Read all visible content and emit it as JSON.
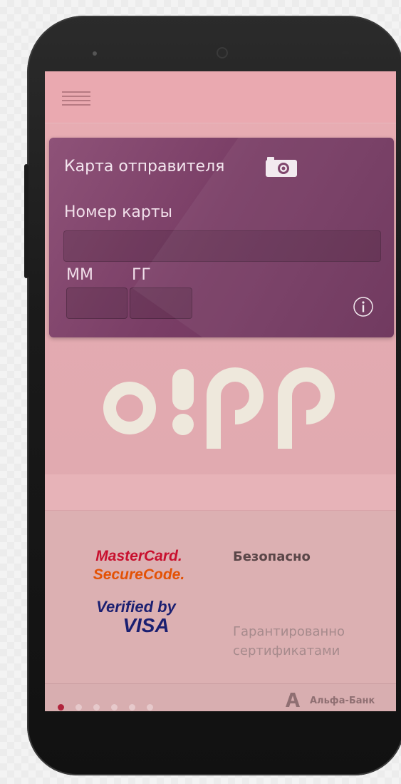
{
  "colors": {
    "screen_bg": "#e8acb3",
    "card_bg": "#7a3e66",
    "logo_fill": "#eee8dc",
    "active_dot": "#b0243c",
    "mastercard_red": "#c8102e",
    "securecode_orange": "#e35205",
    "visa_blue": "#1a1f71"
  },
  "header": {
    "menu_icon": "hamburger-menu-icon"
  },
  "card_form": {
    "title": "Карта отправителя",
    "camera_icon": "camera-icon",
    "card_number_label": "Номер карты",
    "card_number_value": "",
    "month_label": "ММ",
    "year_label": "ГГ",
    "month_value": "",
    "year_value": "",
    "info_icon": "info-icon"
  },
  "brand": {
    "logo_text": "o!pp"
  },
  "security": {
    "mastercard_line1": "MasterCard.",
    "mastercard_line2": "SecureCode.",
    "visa_line1": "Verified by",
    "visa_line2": "VISA",
    "safe_title": "Безопасно",
    "certified_text": "Гарантированно сертификатами"
  },
  "pager": {
    "total": 6,
    "active_index": 0
  },
  "footer": {
    "bank_name": "Альфа-Банк"
  }
}
